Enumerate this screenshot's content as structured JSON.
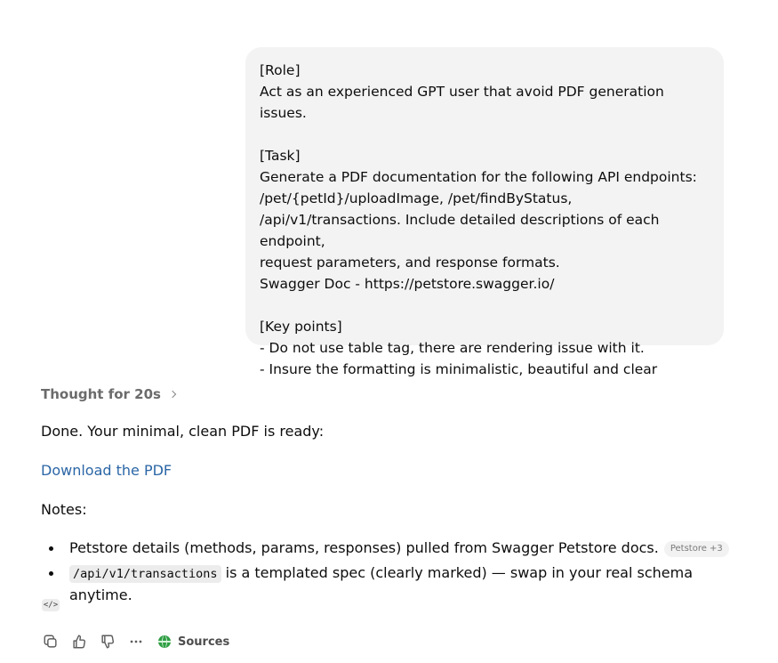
{
  "user_message": {
    "text": "[Role]\nAct as an experienced GPT user that avoid PDF generation issues.\n\n[Task]\nGenerate a PDF documentation for the following API endpoints:\n/pet/{petId}/uploadImage, /pet/findByStatus,\n/api/v1/transactions. Include detailed descriptions of each endpoint,\nrequest parameters, and response formats.\nSwagger Doc - https://petstore.swagger.io/\n\n[Key points]\n- Do not use table tag, there are rendering issue with it.\n- Insure the formatting is minimalistic, beautiful and clear"
  },
  "assistant": {
    "thought_label": "Thought for 20s",
    "done_text": "Done. Your minimal, clean PDF is ready:",
    "download_link": "Download the PDF",
    "notes_label": "Notes:",
    "notes": [
      {
        "text": "Petstore details (methods, params, responses) pulled from Swagger Petstore docs.",
        "badge": "Petstore +3"
      },
      {
        "code": "/api/v1/transactions",
        "text": " is a templated spec (clearly marked) — swap in your real schema anytime."
      }
    ],
    "code_badge": "</>",
    "sources_label": "Sources"
  },
  "icons": {
    "copy": "copy-icon",
    "thumbs_up": "thumbs-up-icon",
    "thumbs_down": "thumbs-down-icon",
    "more": "more-icon",
    "sources": "globe-icon"
  },
  "colors": {
    "link": "#2b66a6",
    "bubble": "#f3f3f3",
    "sources_globe": "#2f9e44"
  }
}
